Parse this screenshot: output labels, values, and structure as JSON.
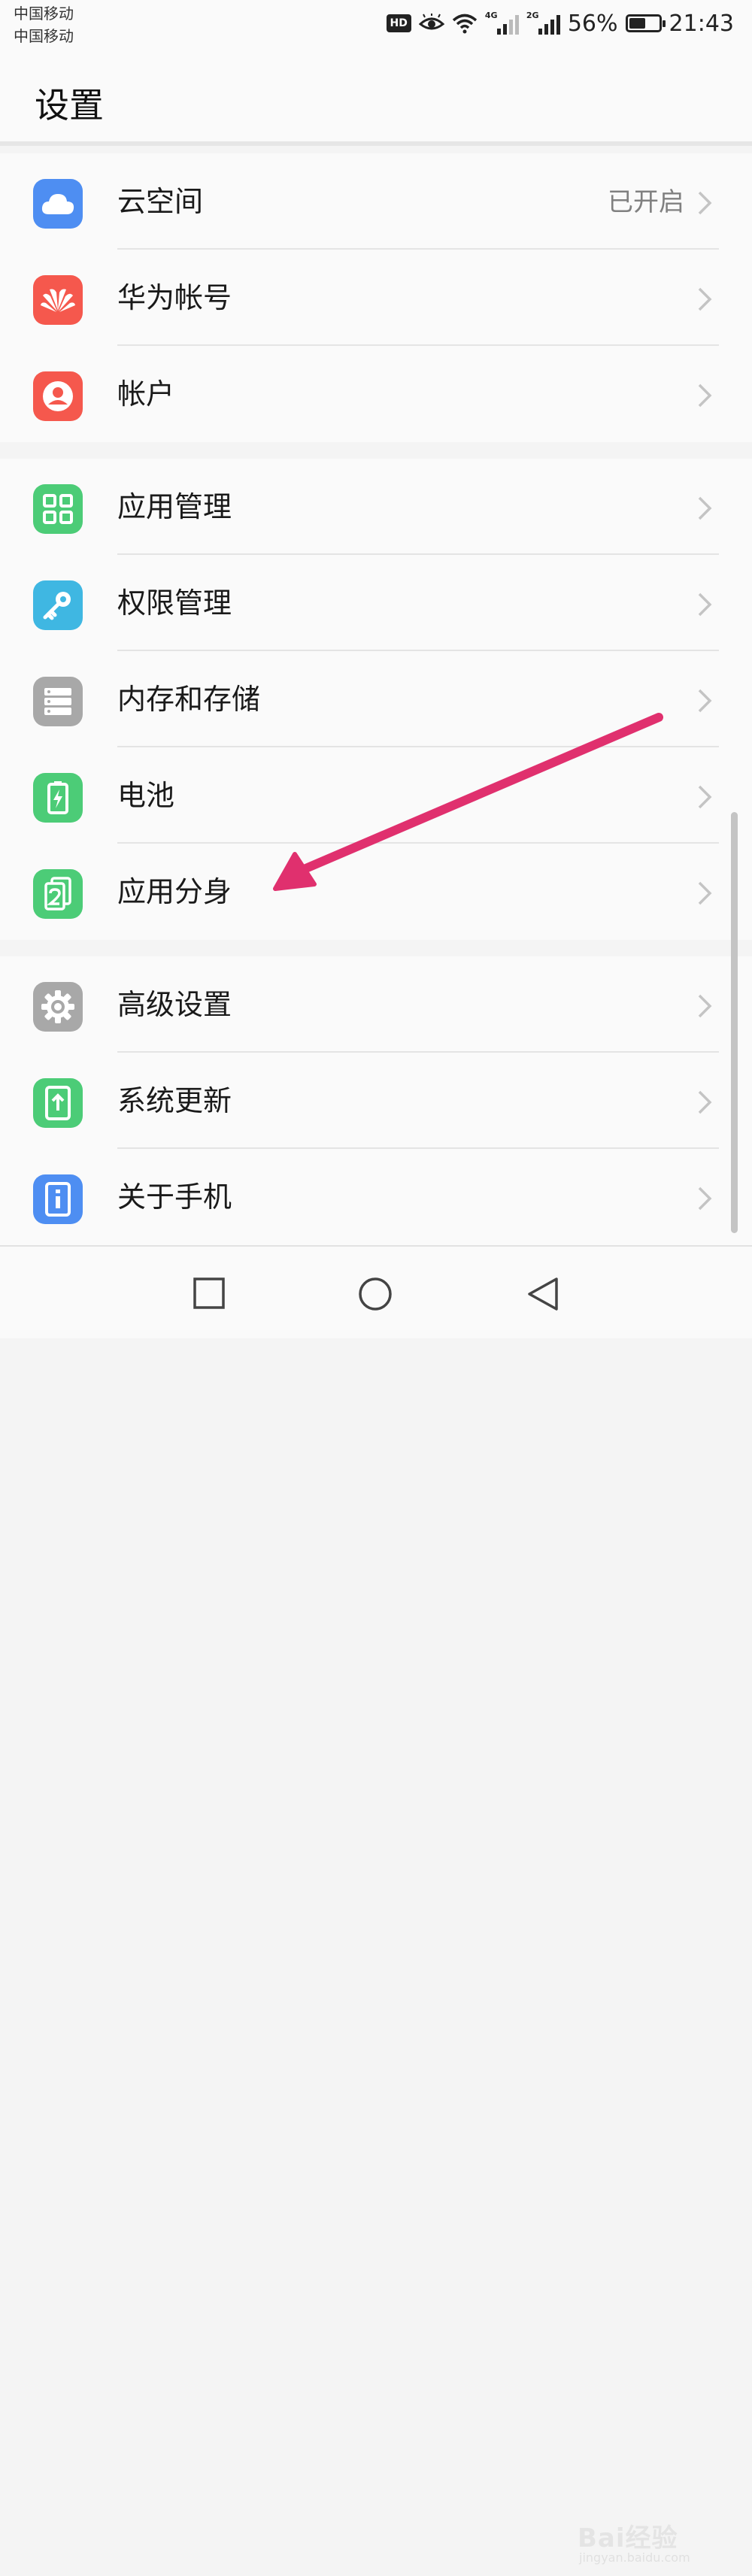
{
  "status_bar": {
    "carrier_1": "中国移动",
    "carrier_2": "中国移动",
    "hd_badge": "HD",
    "network_1": "4G",
    "network_2": "2G",
    "battery_text": "56%",
    "battery_level": 0.56,
    "time": "21:43"
  },
  "header": {
    "title": "设置"
  },
  "groups": [
    {
      "items": [
        {
          "label": "云空间",
          "value": "已开启",
          "icon": "cloud-icon",
          "color": "#4e8ef2"
        },
        {
          "label": "华为帐号",
          "icon": "huawei-logo-icon",
          "color": "#f5584d"
        },
        {
          "label": "帐户",
          "icon": "user-icon",
          "color": "#f5584d"
        }
      ]
    },
    {
      "items": [
        {
          "label": "应用管理",
          "icon": "apps-grid-icon",
          "color": "#4ccc77"
        },
        {
          "label": "权限管理",
          "icon": "key-icon",
          "color": "#3fb7e2"
        },
        {
          "label": "内存和存储",
          "icon": "storage-icon",
          "color": "#a8a8a8"
        },
        {
          "label": "电池",
          "icon": "battery-icon",
          "color": "#4ccc77"
        },
        {
          "label": "应用分身",
          "icon": "app-twin-icon",
          "color": "#4ccc77"
        }
      ]
    },
    {
      "items": [
        {
          "label": "高级设置",
          "icon": "gear-icon",
          "color": "#a8a8a8"
        },
        {
          "label": "系统更新",
          "icon": "system-update-icon",
          "color": "#4ccc77"
        },
        {
          "label": "关于手机",
          "icon": "phone-info-icon",
          "color": "#4e8ef2"
        }
      ]
    }
  ],
  "annotation": {
    "arrow_color": "#e0306e"
  },
  "watermark": {
    "text": "Bai经验",
    "sub": "jingyan.baidu.com"
  }
}
